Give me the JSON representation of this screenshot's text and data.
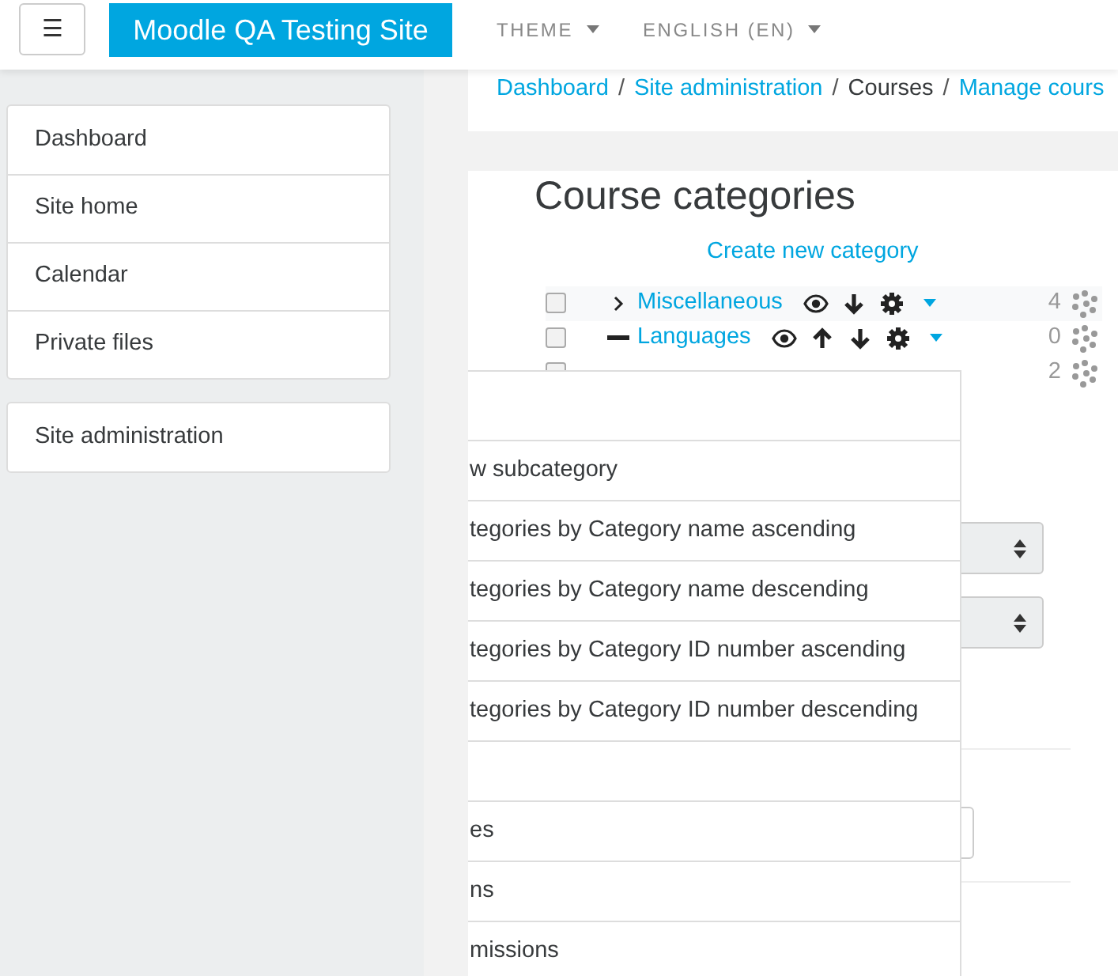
{
  "navbar": {
    "menu_toggle": "☰",
    "brand": "Moodle QA Testing Site",
    "menus": [
      {
        "label": "THEME"
      },
      {
        "label": "ENGLISH (EN)"
      }
    ]
  },
  "sidebar": {
    "groups": [
      [
        {
          "label": "Dashboard"
        },
        {
          "label": "Site home"
        },
        {
          "label": "Calendar"
        },
        {
          "label": "Private files"
        }
      ],
      [
        {
          "label": "Site administration"
        }
      ]
    ]
  },
  "breadcrumb_separator": "/",
  "breadcrumb": [
    {
      "label": "Dashboard",
      "kind": "link"
    },
    {
      "label": "Site administration",
      "kind": "link"
    },
    {
      "label": "Courses",
      "kind": "current"
    },
    {
      "label": "Manage cours",
      "kind": "link"
    }
  ],
  "heading": "Course categories",
  "create_link": "Create new category",
  "categories": [
    {
      "name": "Miscellaneous",
      "checked": false,
      "expanded": false,
      "highlighted": true,
      "can_move_up": false,
      "count": "4"
    },
    {
      "name": "Languages",
      "checked": false,
      "expanded": true,
      "highlighted": false,
      "can_move_up": true,
      "count": "0"
    },
    {
      "checked": false,
      "count": "2"
    }
  ],
  "action_menu": [
    {
      "kind": "blank"
    },
    {
      "kind": "text",
      "label": "w subcategory"
    },
    {
      "kind": "text",
      "label": "tegories by Category name ascending"
    },
    {
      "kind": "text",
      "label": "tegories by Category name descending"
    },
    {
      "kind": "text",
      "label": "tegories by Category ID number ascending"
    },
    {
      "kind": "text",
      "label": "tegories by Category ID number descending"
    },
    {
      "kind": "blank"
    },
    {
      "kind": "text",
      "label": "es"
    },
    {
      "kind": "text",
      "label": "ns"
    },
    {
      "kind": "text",
      "label": "missions"
    }
  ]
}
